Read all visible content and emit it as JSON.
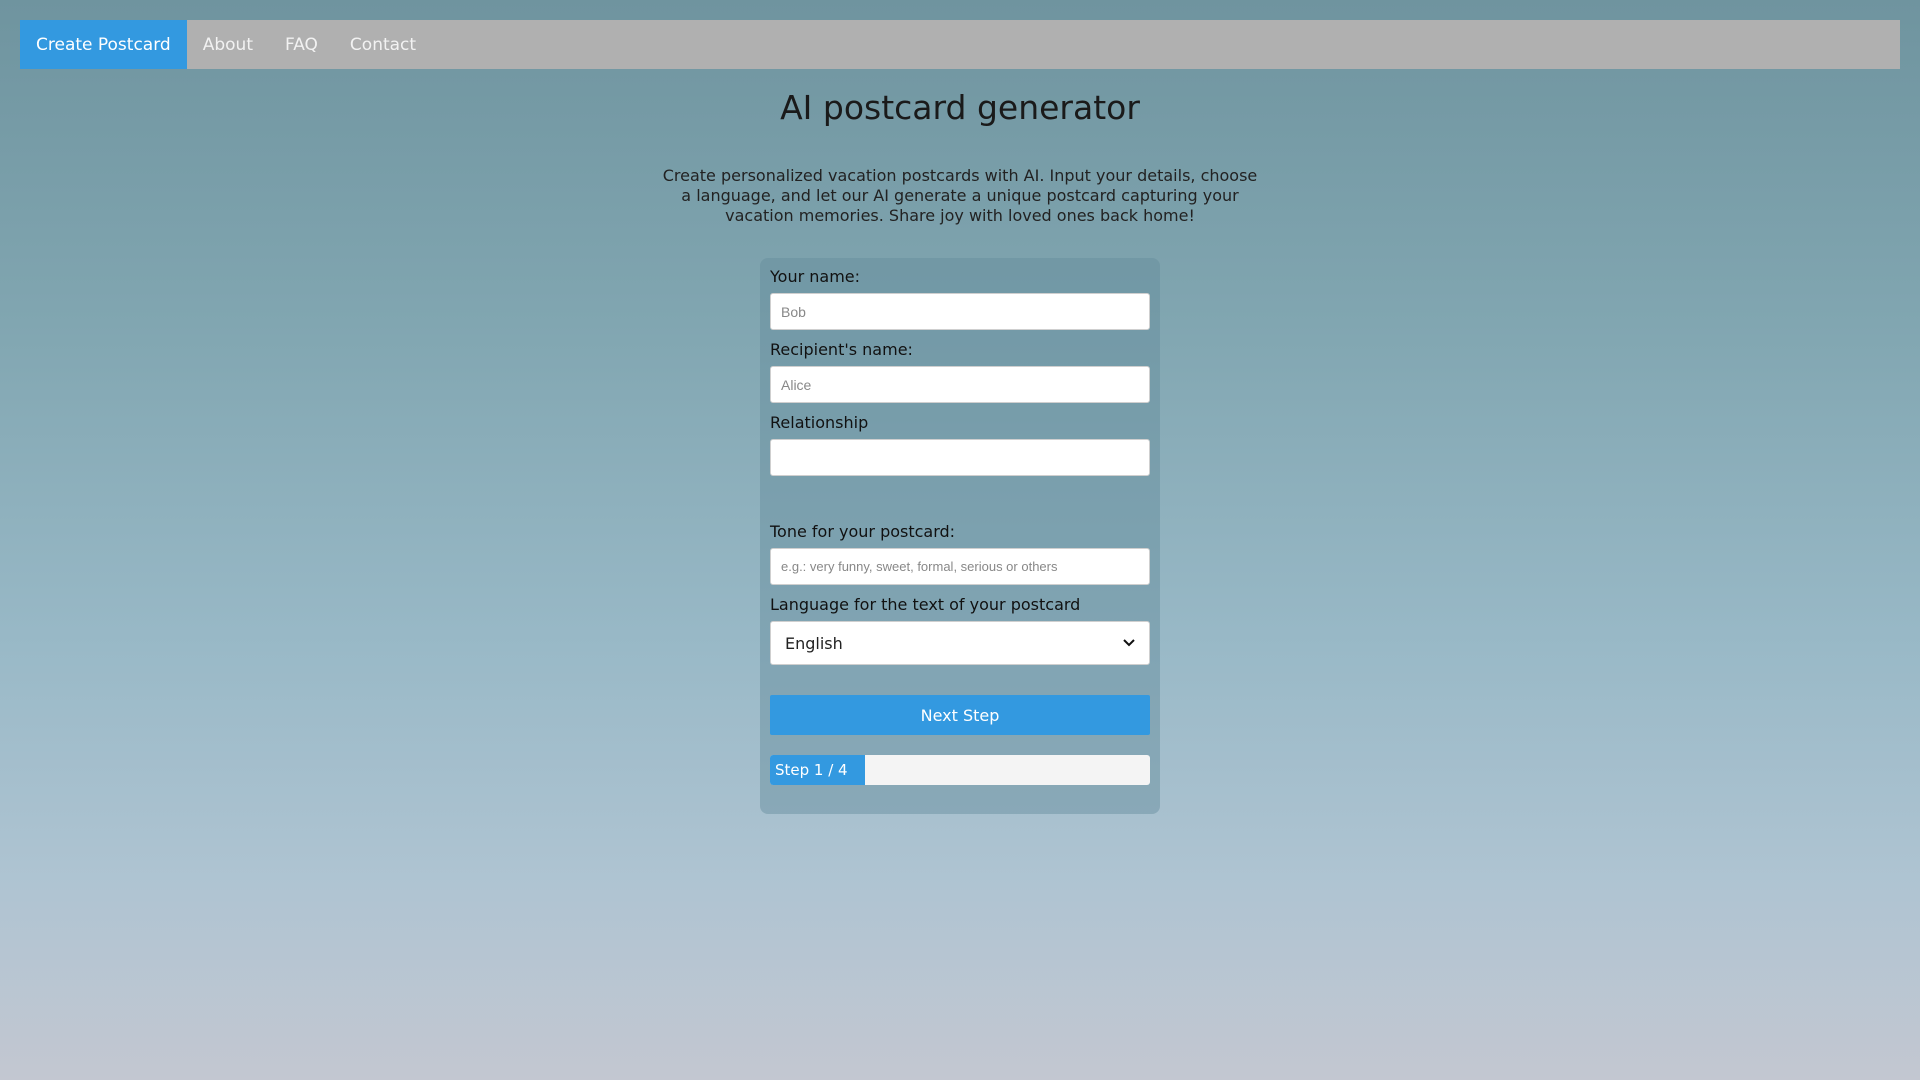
{
  "nav": {
    "items": [
      {
        "label": "Create Postcard",
        "active": true
      },
      {
        "label": "About",
        "active": false
      },
      {
        "label": "FAQ",
        "active": false
      },
      {
        "label": "Contact",
        "active": false
      }
    ]
  },
  "page": {
    "title": "AI postcard generator",
    "intro": "Create personalized vacation postcards with AI. Input your details, choose a language, and let our AI generate a unique postcard capturing your vacation memories. Share joy with loved ones back home!"
  },
  "form": {
    "your_name": {
      "label": "Your name:",
      "placeholder": "Bob",
      "value": ""
    },
    "recipient_name": {
      "label": "Recipient's name:",
      "placeholder": "Alice",
      "value": ""
    },
    "relationship": {
      "label": "Relationship",
      "placeholder": "",
      "value": ""
    },
    "tone": {
      "label": "Tone for your postcard:",
      "placeholder": "e.g.: very funny, sweet, formal, serious or others",
      "value": ""
    },
    "language": {
      "label": "Language for the text of your postcard",
      "selected": "English"
    },
    "next_button": "Next Step",
    "progress": {
      "label": "Step 1 / 4",
      "current_step": 1,
      "total_steps": 4
    }
  },
  "colors": {
    "accent": "#3399e0",
    "navbar": "#b0b0b0"
  },
  "icons": {
    "select_chevron": "chevron-down-icon"
  }
}
